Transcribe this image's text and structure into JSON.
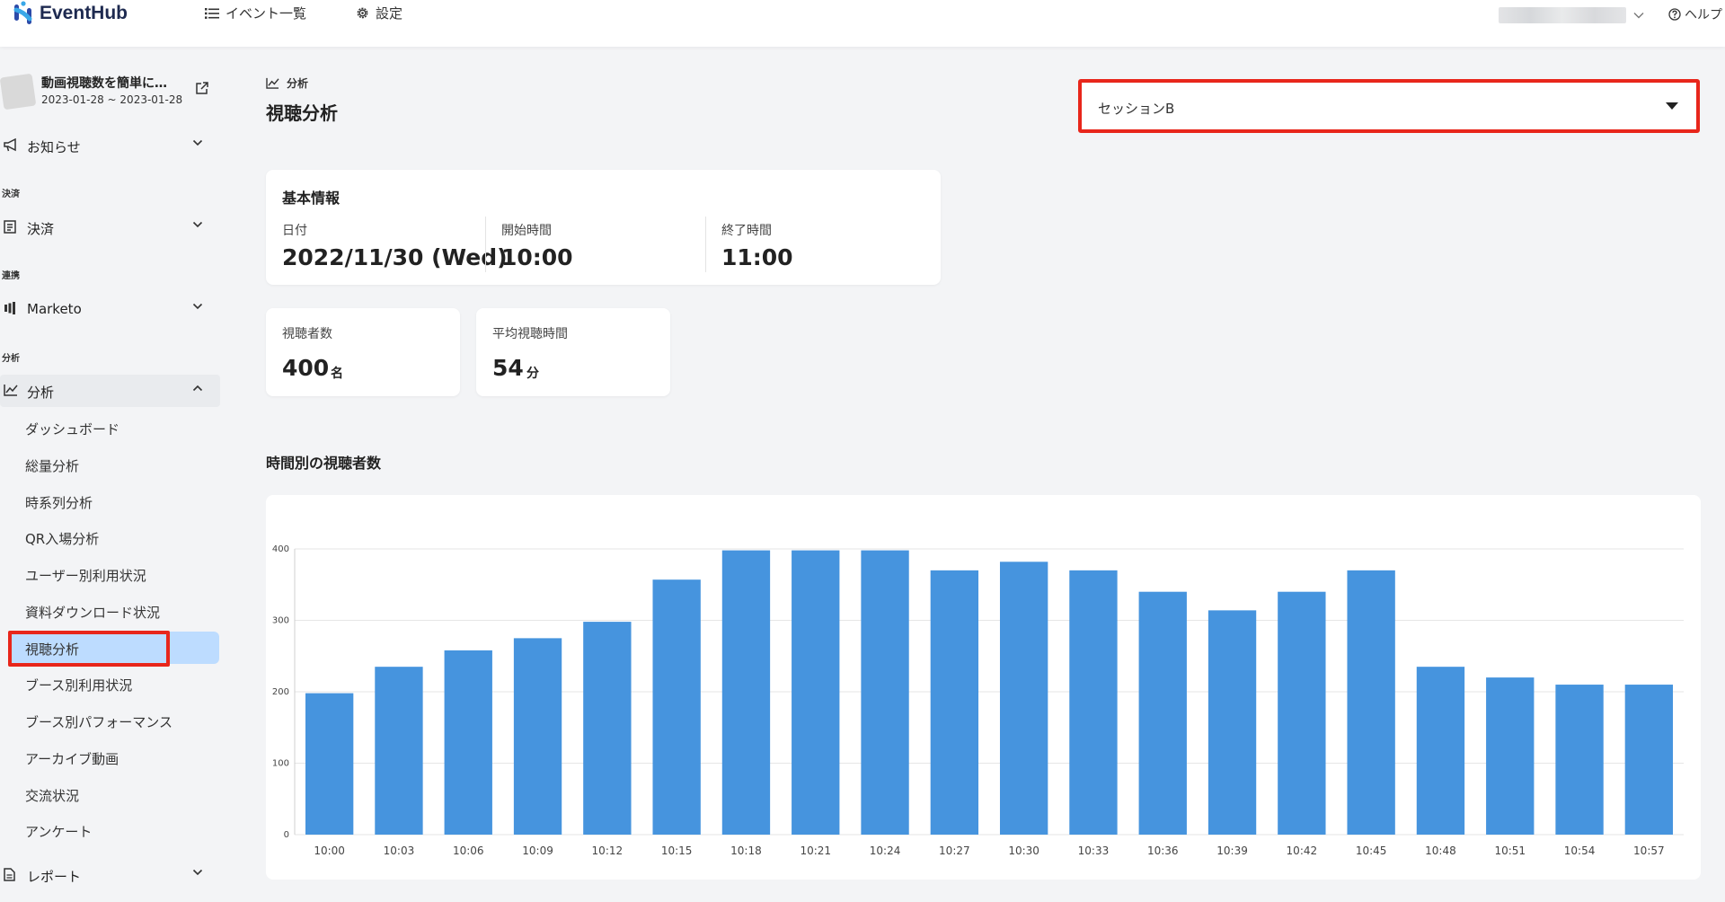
{
  "header": {
    "app_name": "EventHub",
    "nav_events": "イベント一覧",
    "nav_settings": "設定",
    "help": "ヘルプ"
  },
  "event": {
    "title": "動画視聴数を簡単に…",
    "dates": "2023-01-28 ~ 2023-01-28"
  },
  "sidebar": {
    "news": "お知らせ",
    "section_payment": "決済",
    "payment": "決済",
    "section_integration": "連携",
    "marketo": "Marketo",
    "section_analytics": "分析",
    "analytics": "分析",
    "sub_items": [
      "ダッシュボード",
      "総量分析",
      "時系列分析",
      "QR入場分析",
      "ユーザー別利用状況",
      "資料ダウンロード状況",
      "視聴分析",
      "ブース別利用状況",
      "ブース別パフォーマンス",
      "アーカイブ動画",
      "交流状況",
      "アンケート"
    ],
    "active_index": 6,
    "report": "レポート"
  },
  "page": {
    "breadcrumb": "分析",
    "title": "視聴分析",
    "session_value": "セッションB"
  },
  "basic_info": {
    "title": "基本情報",
    "date_label": "日付",
    "date_value": "2022/11/30 (Wed)",
    "start_label": "開始時間",
    "start_value": "10:00",
    "end_label": "終了時間",
    "end_value": "11:00"
  },
  "stats": {
    "viewers_label": "視聴者数",
    "viewers_value": "400",
    "viewers_unit": "名",
    "avg_label": "平均視聴時間",
    "avg_value": "54",
    "avg_unit": "分"
  },
  "chart_heading": "時間別の視聴者数",
  "colors": {
    "bar": "#4694de",
    "highlight": "#e8261b",
    "active_menu": "#bddcff"
  },
  "chart_data": {
    "type": "bar",
    "categories": [
      "10:00",
      "10:03",
      "10:06",
      "10:09",
      "10:12",
      "10:15",
      "10:18",
      "10:21",
      "10:24",
      "10:27",
      "10:30",
      "10:33",
      "10:36",
      "10:39",
      "10:42",
      "10:45",
      "10:48",
      "10:51",
      "10:54",
      "10:57"
    ],
    "values": [
      198,
      235,
      258,
      275,
      298,
      357,
      398,
      398,
      398,
      370,
      382,
      370,
      340,
      314,
      340,
      370,
      235,
      220,
      210,
      210
    ],
    "ylim": [
      0,
      400
    ],
    "yticks": [
      0,
      100,
      200,
      300,
      400
    ],
    "grid": true,
    "title": "",
    "xlabel": "",
    "ylabel": ""
  }
}
